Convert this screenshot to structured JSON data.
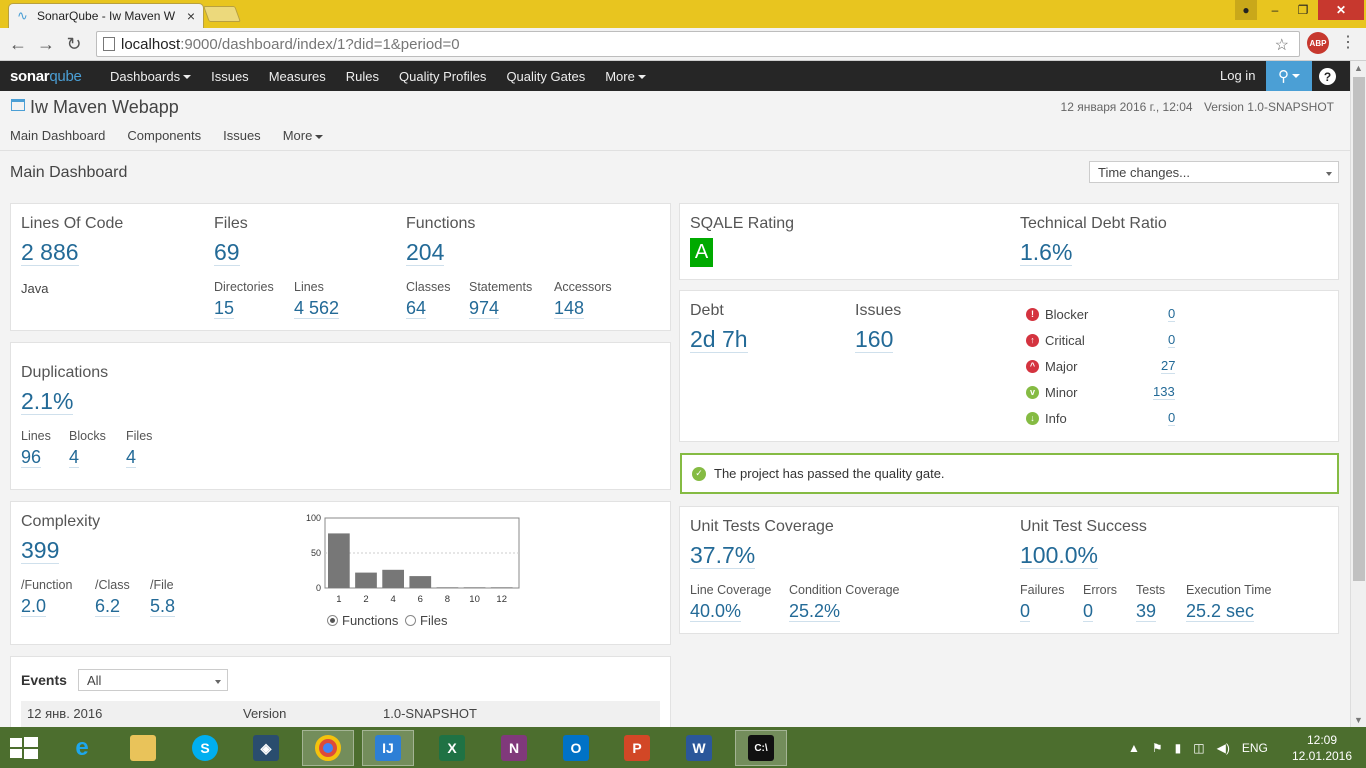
{
  "browser": {
    "tab_title": "SonarQube - Iw Maven W",
    "url_host": "localhost",
    "url_path": ":9000/dashboard/index/1?did=1&period=0",
    "abp": "ABP"
  },
  "nav": {
    "logo_text": "sonar",
    "logo_q": "qube",
    "items": [
      "Dashboards",
      "Issues",
      "Measures",
      "Rules",
      "Quality Profiles",
      "Quality Gates",
      "More"
    ],
    "login": "Log in",
    "help": "?"
  },
  "project": {
    "name": "Iw Maven Webapp",
    "date": "12 января 2016 г., 12:04",
    "version": "Version 1.0-SNAPSHOT",
    "menu": [
      "Main Dashboard",
      "Components",
      "Issues",
      "More"
    ]
  },
  "page": {
    "title": "Main Dashboard",
    "time_changes": "Time changes..."
  },
  "size": {
    "loc_label": "Lines Of Code",
    "loc": "2 886",
    "language": "Java",
    "files_label": "Files",
    "files": "69",
    "dirs_label": "Directories",
    "dirs": "15",
    "lines_label": "Lines",
    "lines": "4 562",
    "functions_label": "Functions",
    "functions": "204",
    "classes_label": "Classes",
    "classes": "64",
    "statements_label": "Statements",
    "statements": "974",
    "accessors_label": "Accessors",
    "accessors": "148"
  },
  "duplications": {
    "label": "Duplications",
    "value": "2.1%",
    "lines_label": "Lines",
    "lines": "96",
    "blocks_label": "Blocks",
    "blocks": "4",
    "files_label": "Files",
    "files": "4"
  },
  "complexity": {
    "label": "Complexity",
    "value": "399",
    "fn_label": "/Function",
    "fn": "2.0",
    "class_label": "/Class",
    "class": "6.2",
    "file_label": "/File",
    "file": "5.8",
    "radio_functions": "Functions",
    "radio_files": "Files"
  },
  "chart_data": {
    "type": "bar",
    "categories": [
      "1",
      "2",
      "4",
      "6",
      "8",
      "10",
      "12"
    ],
    "values": [
      78,
      22,
      26,
      17,
      1,
      1,
      1
    ],
    "ylim": [
      0,
      100
    ],
    "yticks": [
      "100",
      "50",
      "0"
    ],
    "grid": true,
    "bar_color": "#777777"
  },
  "events": {
    "label": "Events",
    "filter": "All",
    "rows": [
      {
        "date": "12 янв. 2016",
        "category": "Version",
        "name": "1.0-SNAPSHOT"
      }
    ]
  },
  "sqale": {
    "rating_label": "SQALE Rating",
    "rating": "A",
    "ratio_label": "Technical Debt Ratio",
    "ratio": "1.6%"
  },
  "issues": {
    "debt_label": "Debt",
    "debt": "2d 7h",
    "issues_label": "Issues",
    "issues": "160",
    "severities": [
      {
        "name": "Blocker",
        "count": "0",
        "color": "#d4333f",
        "icon": "exclamation-icon"
      },
      {
        "name": "Critical",
        "count": "0",
        "color": "#d4333f",
        "icon": "arrow-up-circle-icon"
      },
      {
        "name": "Major",
        "count": "27",
        "color": "#d4333f",
        "icon": "chevron-up-circle-icon"
      },
      {
        "name": "Minor",
        "count": "133",
        "color": "#85bb43",
        "icon": "chevron-down-circle-icon"
      },
      {
        "name": "Info",
        "count": "0",
        "color": "#85bb43",
        "icon": "arrow-down-circle-icon"
      }
    ]
  },
  "quality_gate": {
    "text": "The project has passed the quality gate."
  },
  "coverage": {
    "label": "Unit Tests Coverage",
    "value": "37.7%",
    "line_label": "Line Coverage",
    "line": "40.0%",
    "cond_label": "Condition Coverage",
    "cond": "25.2%"
  },
  "tests": {
    "label": "Unit Test Success",
    "value": "100.0%",
    "failures_label": "Failures",
    "failures": "0",
    "errors_label": "Errors",
    "errors": "0",
    "tests_label": "Tests",
    "tests": "39",
    "time_label": "Execution Time",
    "time": "25.2 sec"
  },
  "taskbar": {
    "apps": [
      "ie",
      "explorer",
      "skype",
      "mysql",
      "chrome",
      "intellij",
      "excel",
      "onenote",
      "outlook",
      "powerpoint",
      "word",
      "cmd"
    ],
    "lang": "ENG",
    "time": "12:09",
    "date": "12.01.2016"
  }
}
